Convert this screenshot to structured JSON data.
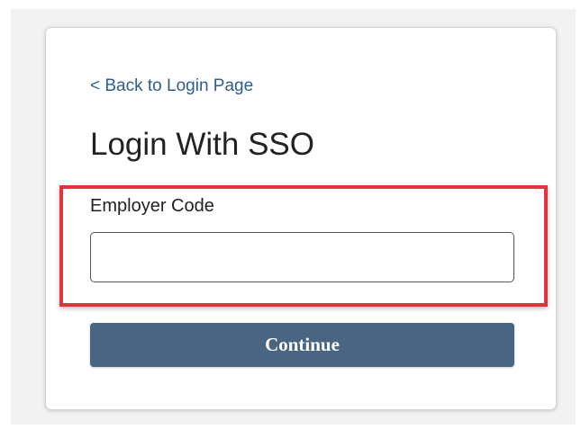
{
  "back_link": "< Back to Login Page",
  "title": "Login With SSO",
  "employer_code": {
    "label": "Employer Code",
    "value": "",
    "placeholder": ""
  },
  "continue_button": "Continue",
  "colors": {
    "link": "#2f5d8f",
    "button": "#4a6582",
    "highlight_border": "#e0353c",
    "background": "#f2f2f2"
  }
}
